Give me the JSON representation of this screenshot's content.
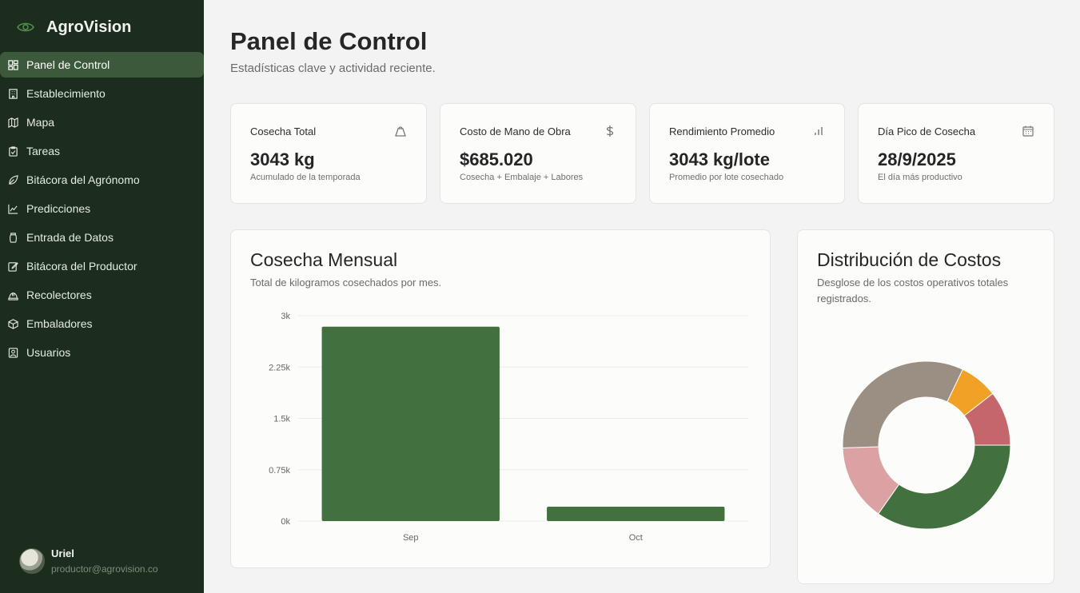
{
  "app": {
    "name": "AgroVision"
  },
  "sidebar": {
    "items": [
      {
        "label": "Panel de Control",
        "icon": "dashboard-icon",
        "active": true
      },
      {
        "label": "Establecimiento",
        "icon": "building-icon"
      },
      {
        "label": "Mapa",
        "icon": "map-icon"
      },
      {
        "label": "Tareas",
        "icon": "clipboard-icon"
      },
      {
        "label": "Bitácora del Agrónomo",
        "icon": "leaf-icon"
      },
      {
        "label": "Predicciones",
        "icon": "line-chart-icon"
      },
      {
        "label": "Entrada de Datos",
        "icon": "jar-icon"
      },
      {
        "label": "Bitácora del Productor",
        "icon": "edit-icon"
      },
      {
        "label": "Recolectores",
        "icon": "hard-hat-icon"
      },
      {
        "label": "Embaladores",
        "icon": "package-icon"
      },
      {
        "label": "Usuarios",
        "icon": "user-square-icon"
      }
    ]
  },
  "user": {
    "name": "Uriel",
    "email": "productor@agrovision.co"
  },
  "page": {
    "title": "Panel de Control",
    "subtitle": "Estadísticas clave y actividad reciente."
  },
  "stats": [
    {
      "label": "Cosecha Total",
      "value": "3043 kg",
      "note": "Acumulado de la temporada",
      "icon": "weight-icon"
    },
    {
      "label": "Costo de Mano de Obra",
      "value": "$685.020",
      "note": "Cosecha + Embalaje + Labores",
      "icon": "dollar-icon"
    },
    {
      "label": "Rendimiento Promedio",
      "value": "3043 kg/lote",
      "note": "Promedio por lote cosechado",
      "icon": "bar-chart-icon"
    },
    {
      "label": "Día Pico de Cosecha",
      "value": "28/9/2025",
      "note": "El día más productivo",
      "icon": "calendar-icon"
    }
  ],
  "monthly": {
    "title": "Cosecha Mensual",
    "subtitle": "Total de kilogramos cosechados por mes."
  },
  "costs": {
    "title": "Distribución de Costos",
    "subtitle": "Desglose de los costos operativos totales registrados."
  },
  "colors": {
    "sidebar": "#1c2d1d",
    "accent": "#42703f",
    "active": "#3c5a3b"
  },
  "chart_data": [
    {
      "type": "bar",
      "categories": [
        "Sep",
        "Oct"
      ],
      "values": [
        2840,
        210
      ],
      "ylim": [
        0,
        3000
      ],
      "yticks": [
        "0k",
        "0.75k",
        "1.5k",
        "2.25k",
        "3k"
      ],
      "ytick_values": [
        0,
        750,
        1500,
        2250,
        3000
      ],
      "grid": true,
      "color": "#42703f"
    },
    {
      "type": "pie",
      "donut": true,
      "values": [
        33,
        14,
        31,
        7,
        10
      ],
      "colors": [
        "#42703f",
        "#dca2a3",
        "#9b8f84",
        "#f2a127",
        "#c4666a"
      ]
    }
  ]
}
